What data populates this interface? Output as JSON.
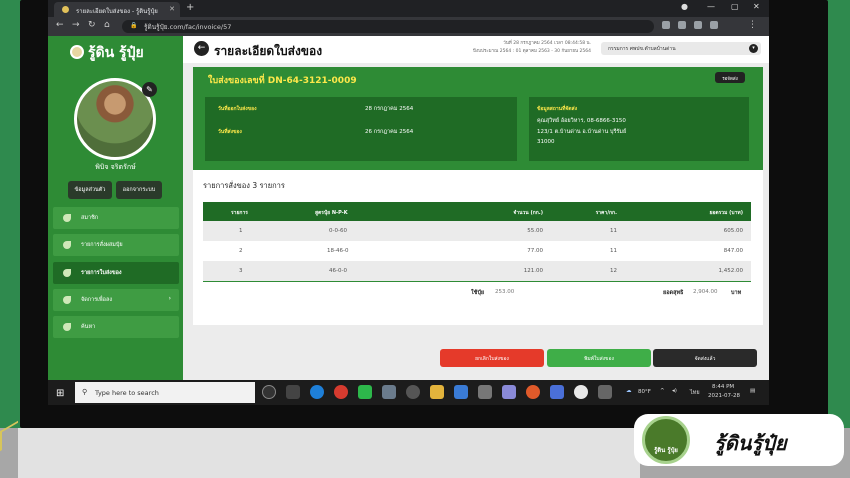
{
  "browser": {
    "tab_title": "รายละเอียดใบส่งของ - รู้ดินรู้ปุ๋ย",
    "url": "รู้ดินรู้ปุ๋ย.com/fac/invoice/57"
  },
  "sidebar": {
    "brand": "รู้ดิน รู้ปุ๋ย",
    "user_name": "พิบิจ จริตรักษ์",
    "profile_btn": "ข้อมูลส่วนตัว",
    "logout_btn": "ออกจากระบบ",
    "menu": [
      {
        "label": "สมาชิก"
      },
      {
        "label": "รายการสั่งผสมปุ๋ย"
      },
      {
        "label": "รายการใบส่งของ"
      },
      {
        "label": "จัดการเพื่อลง"
      },
      {
        "label": "ค้นหา"
      }
    ]
  },
  "header": {
    "title": "รายละเอียดใบส่งของ",
    "date_line1": "วันที่ 28 กรกฎาคม 2564 เวลา 08:44:58 น.",
    "date_line2": "ปีงบประมาณ 2564 : 01 ตุลาคม 2563 - 30 กันยายน 2564",
    "agency": "กรรมการ ศพปข.ตำบลบ้านด่าน"
  },
  "invoice": {
    "number_label": "ใบส่งของเลขที่ DN-64-3121-0009",
    "status": "รอจัดส่ง",
    "order_date_label": "วันที่ออกใบส่งของ",
    "order_date": "28 กรกฎาคม 2564",
    "ship_date_label": "วันที่ส่งของ",
    "ship_date": "26 กรกฎาคม 2564",
    "address_label": "ข้อมูลสถานที่จัดส่ง",
    "address_lines": [
      "คุณสุวิทย์ อ้อยวิหาร, 08-6866-3150",
      "123/1 ต.บ้านด่าน อ.บ้านด่าน บุรีรัมย์",
      "31000"
    ]
  },
  "items": {
    "title": "รายการสั่งของ 3 รายการ",
    "columns": [
      "รายการ",
      "สูตรปุ๋ย N-P-K",
      "จำนวน (กก.)",
      "ราคา/กก.",
      "ยอดรวม (บาท)"
    ],
    "rows": [
      [
        "1",
        "0-0-60",
        "55.00",
        "11",
        "605.00"
      ],
      [
        "2",
        "18-46-0",
        "77.00",
        "11",
        "847.00"
      ],
      [
        "3",
        "46-0-0",
        "121.00",
        "12",
        "1,452.00"
      ]
    ],
    "total_qty_label": "ใช้ปุ๋ย",
    "total_qty": "253.00",
    "net_label": "ยอดสุทธิ",
    "net_total": "2,904.00",
    "currency": "บาท"
  },
  "actions": {
    "cancel": "ยกเลิกใบส่งของ",
    "print": "พิมพ์ใบส่งของ",
    "deliver": "จัดส่งแล้ว"
  },
  "taskbar": {
    "search_placeholder": "Type here to search",
    "weather": "80°F",
    "lang": "ไทย",
    "time": "8:44 PM",
    "date": "2021-07-28"
  },
  "overlay": {
    "channel_logo_text": "รู้ดิน รู้ปุ๋ย",
    "channel_name": "รู้ดินรู้ปุ๋ย"
  },
  "colors": {
    "brand_green": "#2e8b35",
    "dark_green": "#1f6b25",
    "accent_yellow": "#fde84a",
    "cancel_red": "#e53a2a",
    "print_green": "#3fae48",
    "deliver_dark": "#2a2a2a"
  }
}
